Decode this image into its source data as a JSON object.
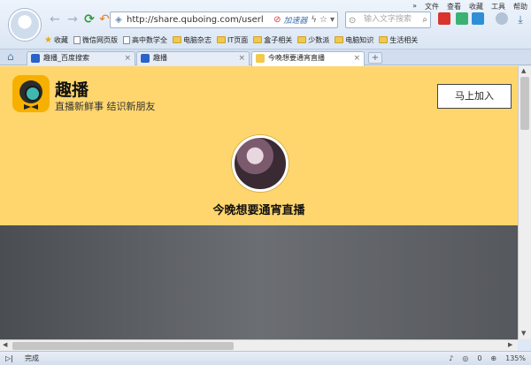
{
  "menu": [
    "文件",
    "查看",
    "收藏",
    "工具",
    "帮助"
  ],
  "menu_more": "»",
  "address": {
    "url": "http://share.quboing.com/userl",
    "accelerator": "加速器",
    "search_placeholder": "输入文字搜索"
  },
  "bookmarks": [
    {
      "label": "收藏",
      "kind": "star"
    },
    {
      "label": "微信网页版",
      "kind": "doc"
    },
    {
      "label": "高中数学全",
      "kind": "doc"
    },
    {
      "label": "电脑杂志",
      "kind": "folder"
    },
    {
      "label": "IT页面",
      "kind": "folder"
    },
    {
      "label": "盒子相关",
      "kind": "folder"
    },
    {
      "label": "少数派",
      "kind": "folder"
    },
    {
      "label": "电脑知识",
      "kind": "folder"
    },
    {
      "label": "生活相关",
      "kind": "folder"
    }
  ],
  "tabs": [
    {
      "label": "趣播_百度搜索",
      "active": false,
      "color": "#2a62c9"
    },
    {
      "label": "趣播",
      "active": false,
      "color": "#2a62c9"
    },
    {
      "label": "今晚想要通宵直播",
      "active": true,
      "color": "#f2c94c"
    }
  ],
  "page": {
    "brand": "趣播",
    "slogan": "直播新鲜事 结识新朋友",
    "join_button": "马上加入",
    "live_title": "今晚想要通宵直播"
  },
  "status": {
    "text": "完成",
    "count": "0",
    "zoom": "135%"
  },
  "colors": {
    "hero_bg": "#ffd66d",
    "logo_bg": "#f7b000"
  }
}
